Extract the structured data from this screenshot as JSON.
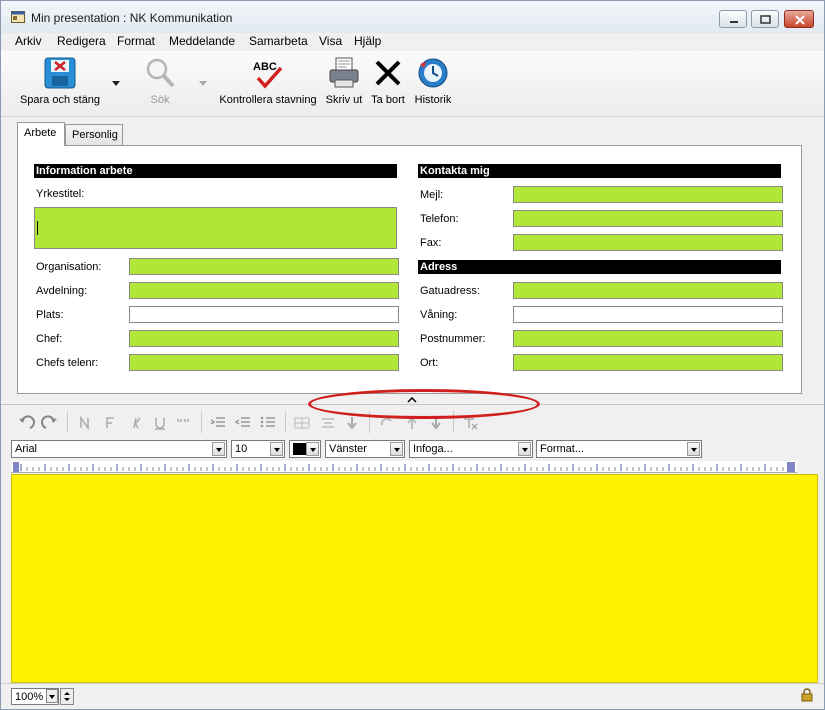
{
  "window": {
    "title": "Min presentation  : NK Kommunikation"
  },
  "menu": [
    "Arkiv",
    "Redigera",
    "Format",
    "Meddelande",
    "Samarbeta",
    "Visa",
    "Hjälp"
  ],
  "toolbar": {
    "save_close": "Spara och stäng",
    "search": "Sök",
    "spellcheck": "Kontrollera stavning",
    "print": "Skriv ut",
    "delete": "Ta bort",
    "history": "Historik",
    "abc": "ABC"
  },
  "tabs": [
    "Arbete",
    "Personlig"
  ],
  "work": {
    "header": "Information arbete",
    "job_title_label": "Yrkestitel:",
    "fields": [
      {
        "label": "Organisation:"
      },
      {
        "label": "Avdelning:"
      },
      {
        "label": "Plats:"
      },
      {
        "label": "Chef:"
      },
      {
        "label": "Chefs telenr:"
      }
    ]
  },
  "contact": {
    "header": "Kontakta mig",
    "fields": [
      {
        "label": "Mejl:"
      },
      {
        "label": "Telefon:"
      },
      {
        "label": "Fax:"
      }
    ]
  },
  "address": {
    "header": "Adress",
    "fields": [
      {
        "label": "Gatuadress:"
      },
      {
        "label": "Våning:"
      },
      {
        "label": "Postnummer:"
      },
      {
        "label": "Ort:"
      }
    ]
  },
  "format_bar": {
    "font": "Arial",
    "size": "10",
    "align": "Vänster",
    "insert": "Infoga...",
    "format": "Format..."
  },
  "status": {
    "zoom": "100%"
  },
  "colors": {
    "field_green": "#b0e637",
    "editor_yellow": "#fff200",
    "annotation_red": "#d0201e"
  }
}
